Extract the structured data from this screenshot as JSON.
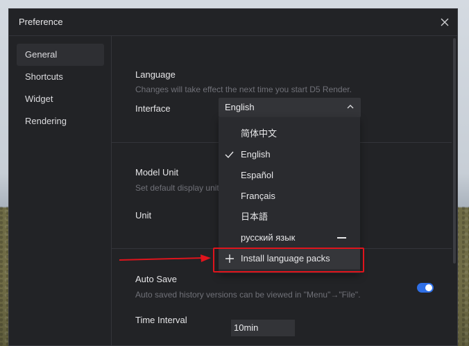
{
  "dialog": {
    "title": "Preference",
    "close_icon": "close-icon"
  },
  "sidebar": {
    "items": [
      {
        "label": "General",
        "active": true
      },
      {
        "label": "Shortcuts",
        "active": false
      },
      {
        "label": "Widget",
        "active": false
      },
      {
        "label": "Rendering",
        "active": false
      }
    ]
  },
  "language": {
    "title": "Language",
    "description": "Changes will take effect the next time you start D5 Render.",
    "interface_label": "Interface",
    "selected": "English",
    "options": [
      "简体中文",
      "English",
      "Español",
      "Français",
      "日本語",
      "русский язык"
    ],
    "install_label": "Install language packs"
  },
  "model_unit": {
    "title": "Model Unit",
    "description": "Set default display unit",
    "unit_label": "Unit"
  },
  "auto_save": {
    "title": "Auto Save",
    "enabled": true,
    "description": "Auto saved history versions can be viewed in \"Menu\"→\"File\".",
    "interval_label": "Time Interval",
    "interval_value": "10min"
  },
  "colors": {
    "dialog_bg": "#222326",
    "accent_toggle": "#2f6fe6",
    "highlight_box": "#e0141c"
  }
}
